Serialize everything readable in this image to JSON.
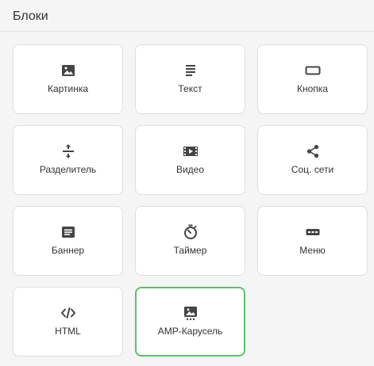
{
  "panel": {
    "title": "Блоки"
  },
  "colors": {
    "icon": "#444444",
    "tile_border": "#dedede",
    "selected_border": "#5cc06b",
    "background": "#f5f5f5"
  },
  "blocks": [
    {
      "label": "Картинка",
      "icon": "image-icon"
    },
    {
      "label": "Текст",
      "icon": "text-icon"
    },
    {
      "label": "Кнопка",
      "icon": "button-icon"
    },
    {
      "label": "Разделитель",
      "icon": "divider-icon"
    },
    {
      "label": "Видео",
      "icon": "video-icon"
    },
    {
      "label": "Соц. сети",
      "icon": "share-icon"
    },
    {
      "label": "Баннер",
      "icon": "banner-icon"
    },
    {
      "label": "Таймер",
      "icon": "timer-icon"
    },
    {
      "label": "Меню",
      "icon": "menu-icon"
    },
    {
      "label": "HTML",
      "icon": "code-icon"
    },
    {
      "label": "AMP-Карусель",
      "icon": "carousel-icon",
      "selected": true
    }
  ]
}
